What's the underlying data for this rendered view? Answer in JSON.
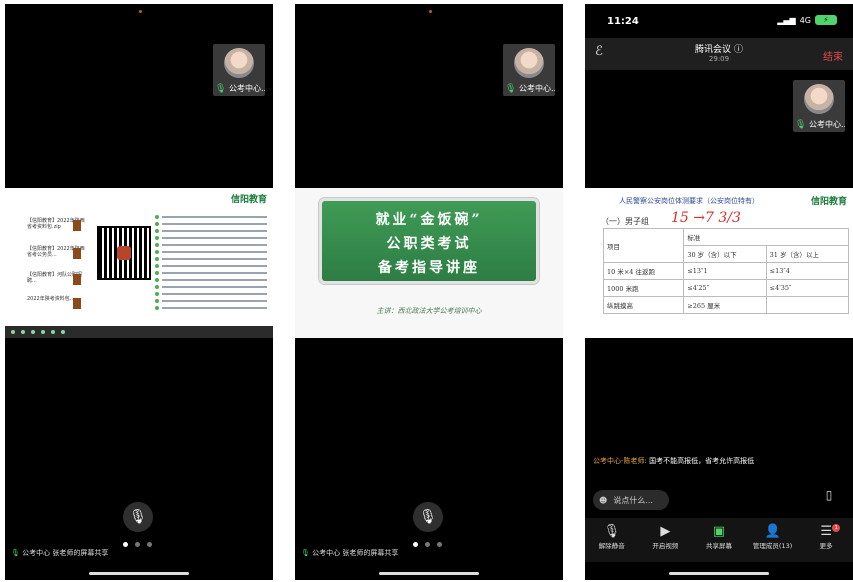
{
  "phone1": {
    "tile_name": "公考中心...",
    "slide": {
      "brand": "信阳教育",
      "files": [
        {
          "name": "【信阳教育】2022年陕西省考资料包.zip"
        },
        {
          "name": "【信阳教育】2022年陕西省考公务员..."
        },
        {
          "name": "【信阳教育】河队公职招聘..."
        },
        {
          "name": "2022年陕考资料包..."
        }
      ]
    },
    "share_label": "公考中心 张老师的屏幕共享"
  },
  "phone2": {
    "tile_name": "公考中心...",
    "slide": {
      "line1": "就业“金饭碗”",
      "line2": "公职类考试",
      "line3": "备考指导讲座",
      "host": "主讲：西北政法大学公考培训中心"
    },
    "share_label": "公考中心 张老师的屏幕共享"
  },
  "phone3": {
    "status_time": "11:24",
    "network": "4G",
    "meeting_title": "腾讯会议",
    "meeting_duration": "29:09",
    "end_label": "结束",
    "tile_name": "公考中心...",
    "slide": {
      "title": "人民警察公安岗位体测要求（公安岗位特有）",
      "brand": "信阳教育",
      "group": "（一）男子组",
      "handwriting": "15 →7 3/3",
      "table": {
        "header_item": "项目",
        "header_std": "标准",
        "age_a": "30 岁（含）以下",
        "age_b": "31 岁（含）以上",
        "rows": [
          {
            "item": "10 米×4 往返跑",
            "a": "≤13″1",
            "b": "≤13″4"
          },
          {
            "item": "1000 米跑",
            "a": "≤4′25″",
            "b": "≤4′35″"
          },
          {
            "item": "纵跳摸高",
            "a": "≥265 厘米",
            "b": ""
          }
        ]
      }
    },
    "chat_who": "公考中心-陈老师:",
    "chat_msg": "国考不能高报低，省考允许高报低",
    "chat_placeholder": "说点什么...",
    "tabs": [
      {
        "label": "解除静音",
        "icon": "mic-muted-icon"
      },
      {
        "label": "开启视频",
        "icon": "video-off-icon"
      },
      {
        "label": "共享屏幕",
        "icon": "screen-share-icon"
      },
      {
        "label": "管理成员(13)",
        "icon": "members-icon"
      },
      {
        "label": "更多",
        "icon": "more-menu-icon"
      }
    ],
    "more_badge": "1"
  },
  "colors": {
    "accent_green": "#4fd36a",
    "end_red": "#e34b4b",
    "chat_name": "#e8a33a",
    "board_green": "#2d7d44"
  }
}
